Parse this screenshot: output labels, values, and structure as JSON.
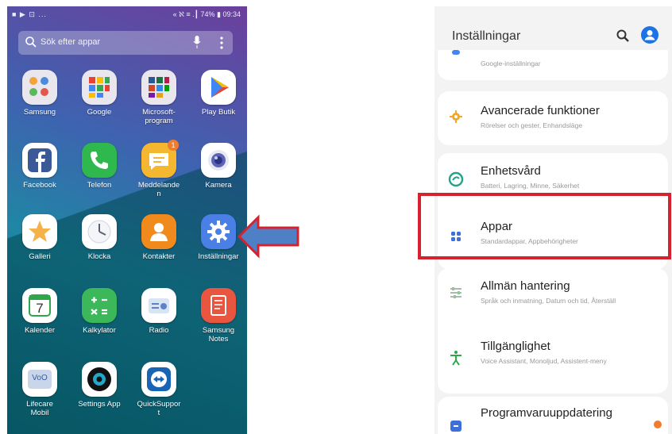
{
  "phone": {
    "status_left": "■ ▶ ⊡ ...",
    "status_right": "« ℵ ≡ .┃ 74% ▮ 09:34",
    "search_placeholder": "Sök efter appar",
    "apps": [
      {
        "label": "Samsung",
        "icon": "samsung-folder-icon"
      },
      {
        "label": "Google",
        "icon": "google-folder-icon"
      },
      {
        "label": "Microsoft-\nprogram",
        "icon": "microsoft-folder-icon"
      },
      {
        "label": "Play Butik",
        "icon": "play-store-icon"
      },
      {
        "label": "Facebook",
        "icon": "facebook-icon"
      },
      {
        "label": "Telefon",
        "icon": "phone-icon"
      },
      {
        "label": "Meddelande\nn",
        "icon": "messages-icon",
        "badge": "1"
      },
      {
        "label": "Kamera",
        "icon": "camera-icon"
      },
      {
        "label": "Galleri",
        "icon": "gallery-icon"
      },
      {
        "label": "Klocka",
        "icon": "clock-icon"
      },
      {
        "label": "Kontakter",
        "icon": "contacts-icon"
      },
      {
        "label": "Inställningar",
        "icon": "settings-gear-icon"
      },
      {
        "label": "Kalender",
        "icon": "calendar-icon",
        "glyph": "7"
      },
      {
        "label": "Kalkylator",
        "icon": "calculator-icon"
      },
      {
        "label": "Radio",
        "icon": "radio-icon"
      },
      {
        "label": "Samsung\nNotes",
        "icon": "notes-icon"
      },
      {
        "label": "Lifecare\nMobil",
        "icon": "lifecare-icon",
        "glyph": "VoO"
      },
      {
        "label": "Settings App",
        "icon": "settings-app-icon"
      },
      {
        "label": "QuickSuppor\nt",
        "icon": "quicksupport-icon"
      }
    ]
  },
  "settings": {
    "title": "Inställningar",
    "items": [
      {
        "title": "",
        "subtitle": "Google-inställningar",
        "icon": "google-icon"
      },
      {
        "title": "Avancerade funktioner",
        "subtitle": "Rörelser och gester, Enhandsläge",
        "icon": "advanced-features-icon"
      },
      {
        "title": "Enhetsvård",
        "subtitle": "Batteri, Lagring, Minne, Säkerhet",
        "icon": "device-care-icon"
      },
      {
        "title": "Appar",
        "subtitle": "Standardappar, Appbehörigheter",
        "icon": "apps-grid-icon"
      },
      {
        "title": "Allmän hantering",
        "subtitle": "Språk och inmatning, Datum och tid, Återställ",
        "icon": "general-management-icon"
      },
      {
        "title": "Tillgänglighet",
        "subtitle": "Voice Assistant, Monoljud, Assistent-meny",
        "icon": "accessibility-icon"
      },
      {
        "title": "Programvaruuppdatering",
        "subtitle": "",
        "icon": "software-update-icon"
      }
    ]
  },
  "colors": {
    "highlight": "#d6212f",
    "arrow_fill": "#4f7fc4",
    "arrow_stroke": "#d6212f",
    "accent_blue": "#1a73e8"
  }
}
